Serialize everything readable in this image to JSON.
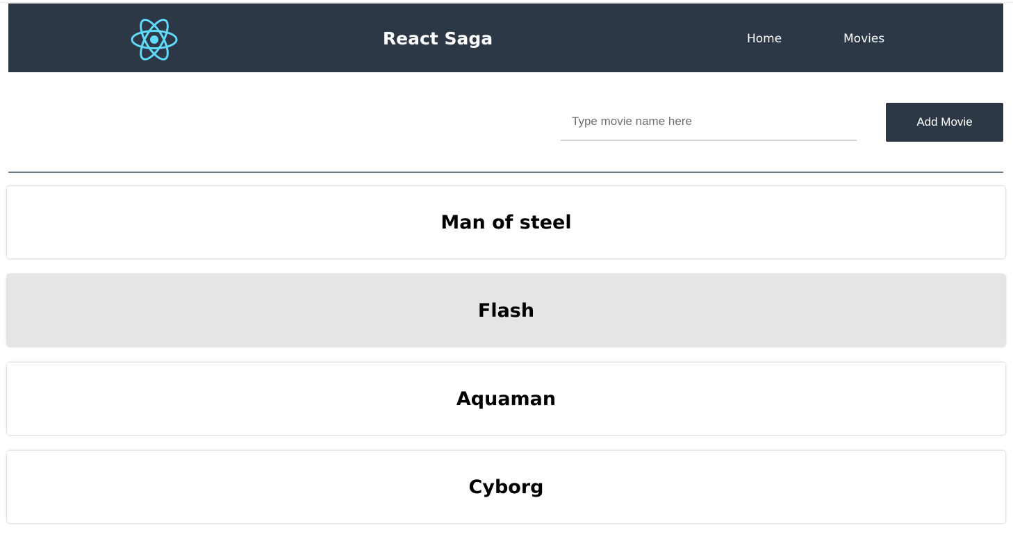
{
  "colors": {
    "navbar_bg": "#2c3846",
    "logo_accent": "#61dafb",
    "button_bg": "#2c3846",
    "selected_card_bg": "#e5e5e5"
  },
  "header": {
    "logo_icon": "react-atom-icon",
    "brand": "React Saga",
    "nav": [
      {
        "label": "Home"
      },
      {
        "label": "Movies"
      }
    ]
  },
  "form": {
    "input_placeholder": "Type movie name here",
    "input_value": "",
    "add_button_label": "Add Movie"
  },
  "movies": [
    {
      "title": "Man of steel",
      "selected": false
    },
    {
      "title": "Flash",
      "selected": true
    },
    {
      "title": "Aquaman",
      "selected": false
    },
    {
      "title": "Cyborg",
      "selected": false
    }
  ]
}
